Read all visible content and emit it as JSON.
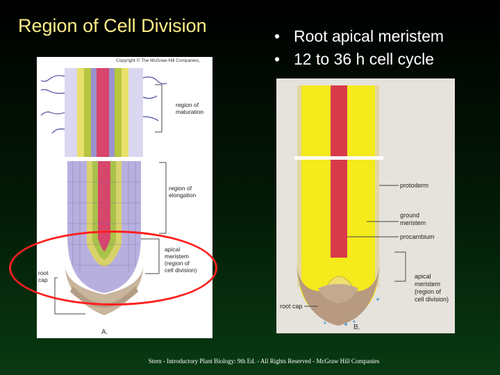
{
  "title": "Region of Cell Division",
  "bullets": [
    "Root apical meristem",
    "12 to 36 h cell cycle"
  ],
  "bullet_glyph": "•",
  "figure_a": {
    "copyright": "Copyright © The McGraw-Hill Companies,",
    "labels": {
      "maturation": [
        "region of",
        "maturation"
      ],
      "elongation": [
        "region of",
        "elongation"
      ],
      "apical": [
        "apical",
        "meristem",
        "(region of",
        "cell division)"
      ],
      "root_cap": [
        "root",
        "cap"
      ]
    },
    "panel_letter": "A."
  },
  "figure_b": {
    "labels": {
      "protoderm": "protoderm",
      "ground": [
        "ground",
        "meristem"
      ],
      "procambium": "procambium",
      "apical": [
        "apical",
        "meristem",
        "(region of",
        "cell division)"
      ],
      "root_cap": "root cap"
    },
    "panel_letter": "B."
  },
  "credit": "Stern - Introductory Plant Biology: 9th Ed. - All Rights Reserved - McGraw Hill Companies",
  "colors": {
    "title": "#ffee88",
    "bullets": "#ffffff",
    "highlight": "#ff2020",
    "procambium": "#d93a4a",
    "ground_meristem": "#f4ea1c",
    "root_cap": "#b79a80"
  }
}
